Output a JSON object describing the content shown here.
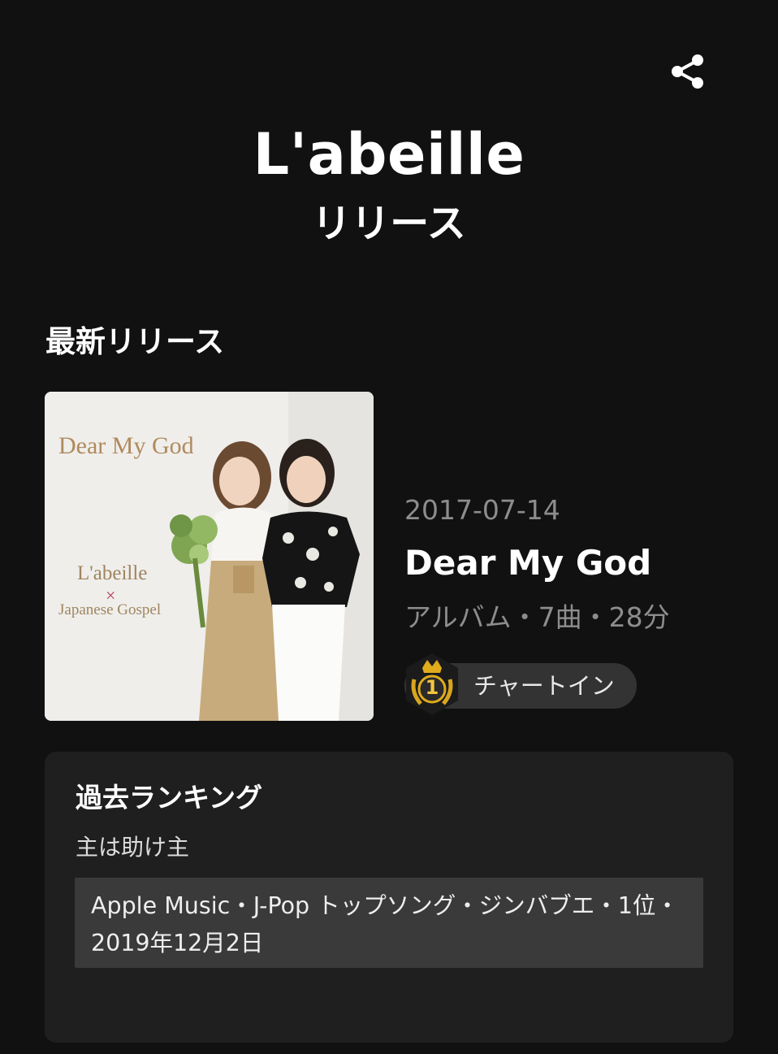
{
  "header": {
    "artist_name": "L'abeille",
    "page_subtitle": "リリース",
    "share_icon": "share-icon"
  },
  "latest_release": {
    "section_title": "最新リリース",
    "cover_art": {
      "title_text": "Dear My God",
      "artist_text": "L'abeille",
      "cross_mark": "×",
      "collab_text": "Japanese Gospel"
    },
    "release_date": "2017-07-14",
    "title": "Dear My God",
    "meta": "アルバム・7曲・28分",
    "chart_badge": {
      "rank": "1",
      "label": "チャートイン",
      "icon": "crown-medal-icon"
    }
  },
  "past_ranking": {
    "title": "過去ランキング",
    "song": "主は助け主",
    "entry_line1": "Apple Music・J-Pop トップソング・ジンバブエ・1位・",
    "entry_line2": "2019年12月2日"
  },
  "colors": {
    "background": "#111111",
    "card": "#1f1f1f",
    "entry_box": "#3a3a3a",
    "muted_text": "#8d8d8d",
    "gold": "#d9a520"
  }
}
